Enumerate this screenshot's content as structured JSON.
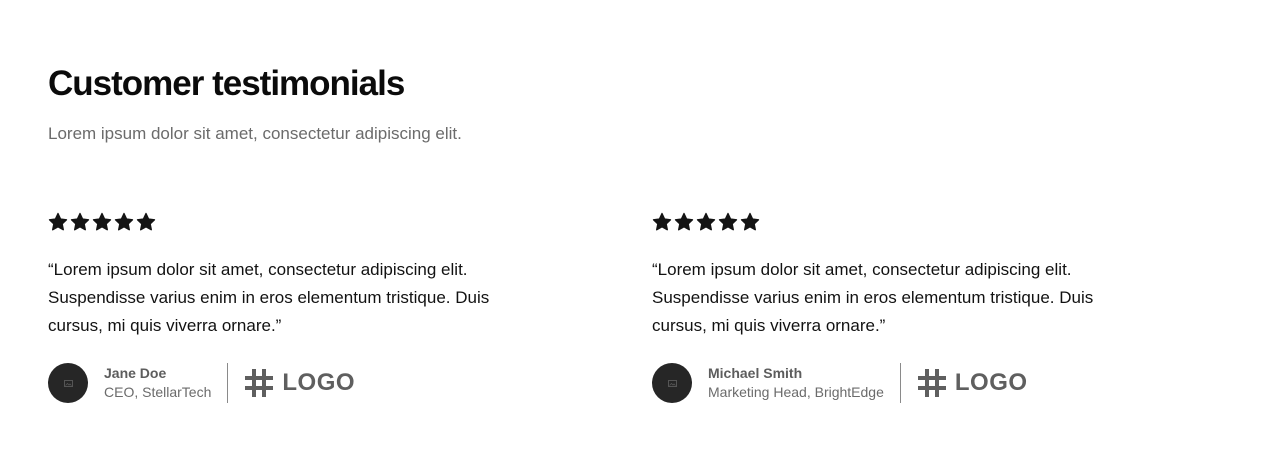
{
  "section": {
    "title": "Customer testimonials",
    "subtitle": "Lorem ipsum dolor sit amet, consectetur adipiscing elit."
  },
  "colors": {
    "star": "#141414",
    "avatar_bg": "#262626",
    "muted_text": "#6b6b6b"
  },
  "testimonials": [
    {
      "rating": 5,
      "quote": "“Lorem ipsum dolor sit amet, consectetur adipiscing elit. Suspendisse varius enim in eros elementum tristique. Duis cursus, mi quis viverra ornare.”",
      "name": "Jane Doe",
      "role": "CEO, StellarTech",
      "avatar_icon": "image-placeholder-icon",
      "logo_icon": "hash-logo-icon",
      "logo_text": "LOGO"
    },
    {
      "rating": 5,
      "quote": "“Lorem ipsum dolor sit amet, consectetur adipiscing elit. Suspendisse varius enim in eros elementum tristique. Duis cursus, mi quis viverra ornare.”",
      "name": "Michael Smith",
      "role": "Marketing Head, BrightEdge",
      "avatar_icon": "image-placeholder-icon",
      "logo_icon": "hash-logo-icon",
      "logo_text": "LOGO"
    }
  ]
}
